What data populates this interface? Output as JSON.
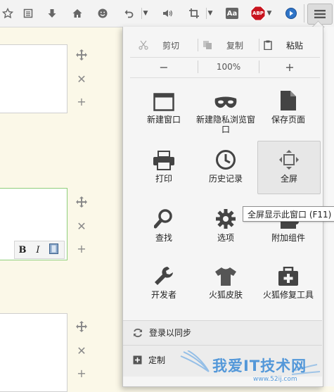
{
  "toolbar": {
    "items": [
      "star-icon",
      "reader-icon",
      "download-icon",
      "home-icon",
      "smiley-icon",
      "undo-icon",
      "speaker-icon",
      "crop-icon",
      "font-icon",
      "abp-icon",
      "media-icon",
      "menu-icon"
    ],
    "abp_label": "ABP",
    "font_label": "Aa"
  },
  "edit": {
    "cut": "剪切",
    "copy": "复制",
    "paste": "粘贴"
  },
  "zoom": {
    "minus": "−",
    "value": "100%",
    "plus": "+"
  },
  "menu_items": [
    {
      "label": "新建窗口",
      "icon": "new-window-icon"
    },
    {
      "label": "新建隐私浏览窗口",
      "icon": "private-mask-icon"
    },
    {
      "label": "保存页面",
      "icon": "save-page-icon"
    },
    {
      "label": "打印",
      "icon": "printer-icon"
    },
    {
      "label": "历史记录",
      "icon": "history-clock-icon"
    },
    {
      "label": "全屏",
      "icon": "fullscreen-icon"
    },
    {
      "label": "查找",
      "icon": "magnifier-icon"
    },
    {
      "label": "选项",
      "icon": "gear-icon"
    },
    {
      "label": "附加组件",
      "icon": "puzzle-icon"
    },
    {
      "label": "开发者",
      "icon": "wrench-icon"
    },
    {
      "label": "火狐皮肤",
      "icon": "tshirt-icon"
    },
    {
      "label": "火狐修复工具",
      "icon": "repair-kit-icon"
    }
  ],
  "tooltip": "全屏显示此窗口 (F11)",
  "footer": {
    "sync": "登录以同步",
    "customize": "定制"
  },
  "editor": {
    "bold": "B",
    "italic": "I"
  },
  "watermark": {
    "text": "我爱IT技术网",
    "url": "www.52ij.com"
  },
  "colors": {
    "panel_bg": "#f5f5f5",
    "page_bg": "#fbf8e8",
    "abp_red": "#c8141e",
    "focus_border": "#8fcf7b"
  }
}
